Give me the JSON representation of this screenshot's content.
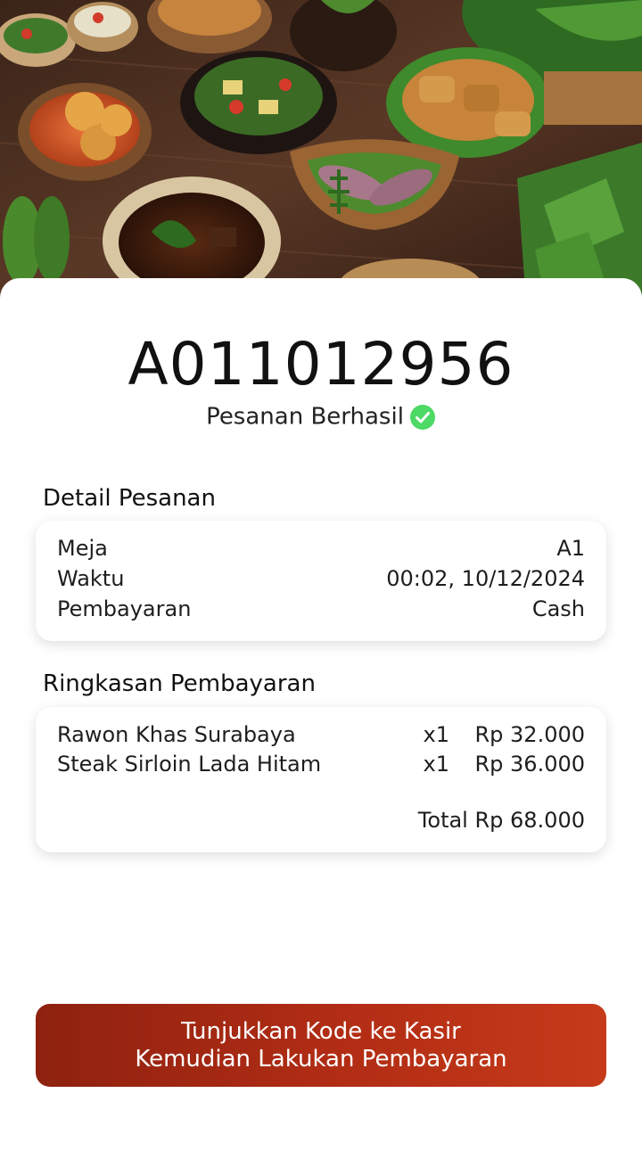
{
  "hero": {
    "image_name": "indonesian-food-spread-photo"
  },
  "order": {
    "code": "A011012956",
    "status": "Pesanan Berhasil",
    "status_icon": "check-circle-icon",
    "status_color": "#4cd964"
  },
  "detail": {
    "title": "Detail Pesanan",
    "rows": [
      {
        "label": "Meja",
        "value": "A1"
      },
      {
        "label": "Waktu",
        "value": "00:02, 10/12/2024"
      },
      {
        "label": "Pembayaran",
        "value": "Cash"
      }
    ]
  },
  "summary": {
    "title": "Ringkasan Pembayaran",
    "items": [
      {
        "name": "Rawon Khas Surabaya",
        "qty": "x1",
        "price": "Rp 32.000"
      },
      {
        "name": "Steak Sirloin Lada Hitam",
        "qty": "x1",
        "price": "Rp 36.000"
      }
    ],
    "total": "Total Rp 68.000"
  },
  "cta": {
    "line1": "Tunjukkan Kode ke Kasir",
    "line2": "Kemudian Lakukan Pembayaran",
    "color": "#b02c14"
  }
}
